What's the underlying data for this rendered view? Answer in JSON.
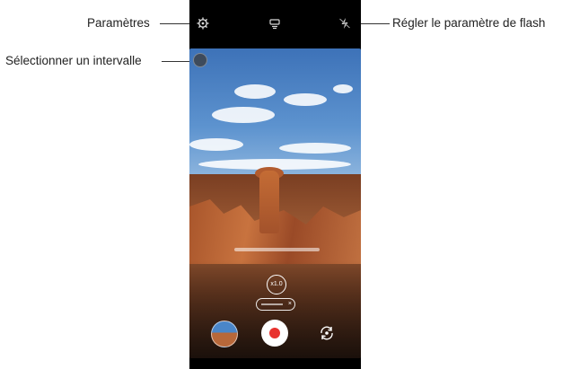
{
  "callouts": {
    "settings": "Paramètres",
    "interval": "Sélectionner un intervalle",
    "flash": "Régler le paramètre de flash"
  },
  "camera": {
    "zoom_label": "x1.0"
  },
  "icons": [
    "gear-icon",
    "interval-icon",
    "flash-icon",
    "gallery-thumbnail",
    "record-button",
    "switch-camera-icon"
  ],
  "colors": {
    "record": "#e8322e",
    "sky": "#4f86c6"
  }
}
